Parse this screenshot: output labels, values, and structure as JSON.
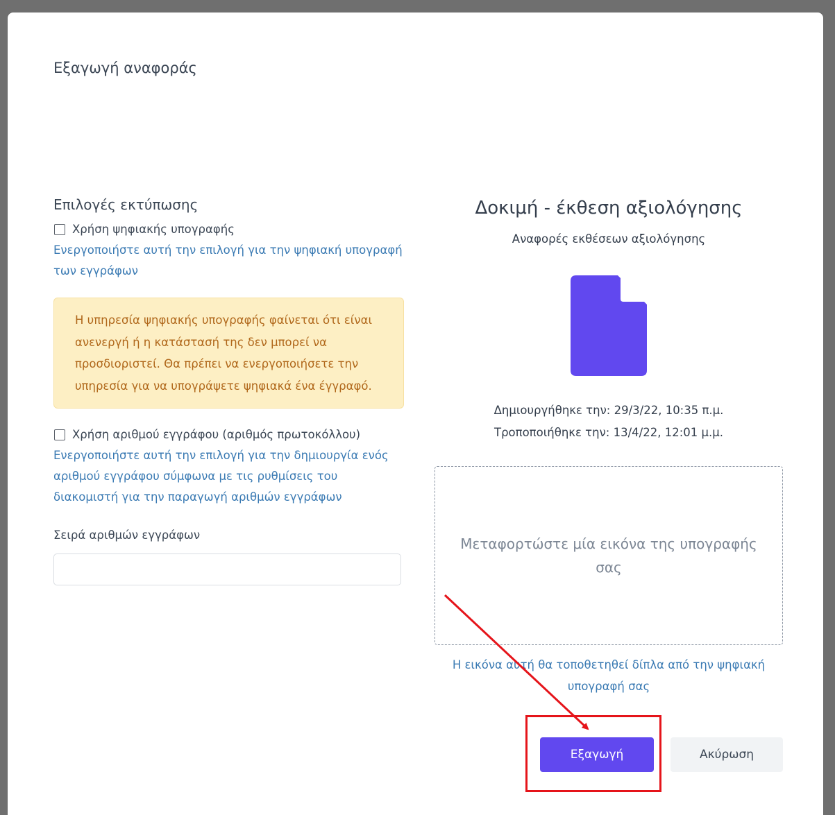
{
  "dialog": {
    "title": "Εξαγωγή αναφοράς"
  },
  "print_options": {
    "heading": "Επιλογές εκτύπωσης",
    "digital_signature": {
      "label": "Χρήση ψηφιακής υπογραφής",
      "checked": false,
      "help": "Ενεργοποιήστε αυτή την επιλογή για την ψηφιακή υπογραφή των εγγράφων"
    },
    "warning": "Η υπηρεσία ψηφιακής υπογραφής φαίνεται ότι είναι ανενεργή ή η κατάστασή της δεν μπορεί να προσδιοριστεί. Θα πρέπει να ενεργοποιήσετε την υπηρεσία για να υπογράψετε ψηφιακά ένα έγγραφό.",
    "document_number": {
      "label": "Χρήση αριθμού εγγράφου (αριθμός πρωτοκόλλου)",
      "checked": false,
      "help": "Ενεργοποιήστε αυτή την επιλογή για την δημιουργία ενός αριθμού εγγράφου σύμφωνα με τις ρυθμίσεις του διακομιστή για την παραγωγή αριθμών εγγράφων"
    },
    "series": {
      "label": "Σειρά αριθμών εγγράφων",
      "value": "",
      "placeholder": ""
    }
  },
  "document": {
    "title": "Δοκιμή - έκθεση αξιολόγησης",
    "subtitle": "Αναφορές εκθέσεων αξιολόγησης",
    "icon": "file-icon",
    "created": "Δημιουργήθηκε την: 29/3/22, 10:35 π.μ.",
    "modified": "Τροποποιήθηκε την: 13/4/22, 12:01 μ.μ.",
    "upload_text": "Μεταφορτώστε μία εικόνα της υπογραφής σας",
    "upload_help": "Η εικόνα αυτή θα τοποθετηθεί δίπλα από την ψηφιακή υπογραφή σας"
  },
  "actions": {
    "export": "Εξαγωγή",
    "cancel": "Ακύρωση"
  },
  "colors": {
    "primary": "#6148ef",
    "link_text": "#3a7ab3",
    "warning_bg": "#fdefc4",
    "warning_text": "#b0671a",
    "annotation": "#e5141a"
  }
}
